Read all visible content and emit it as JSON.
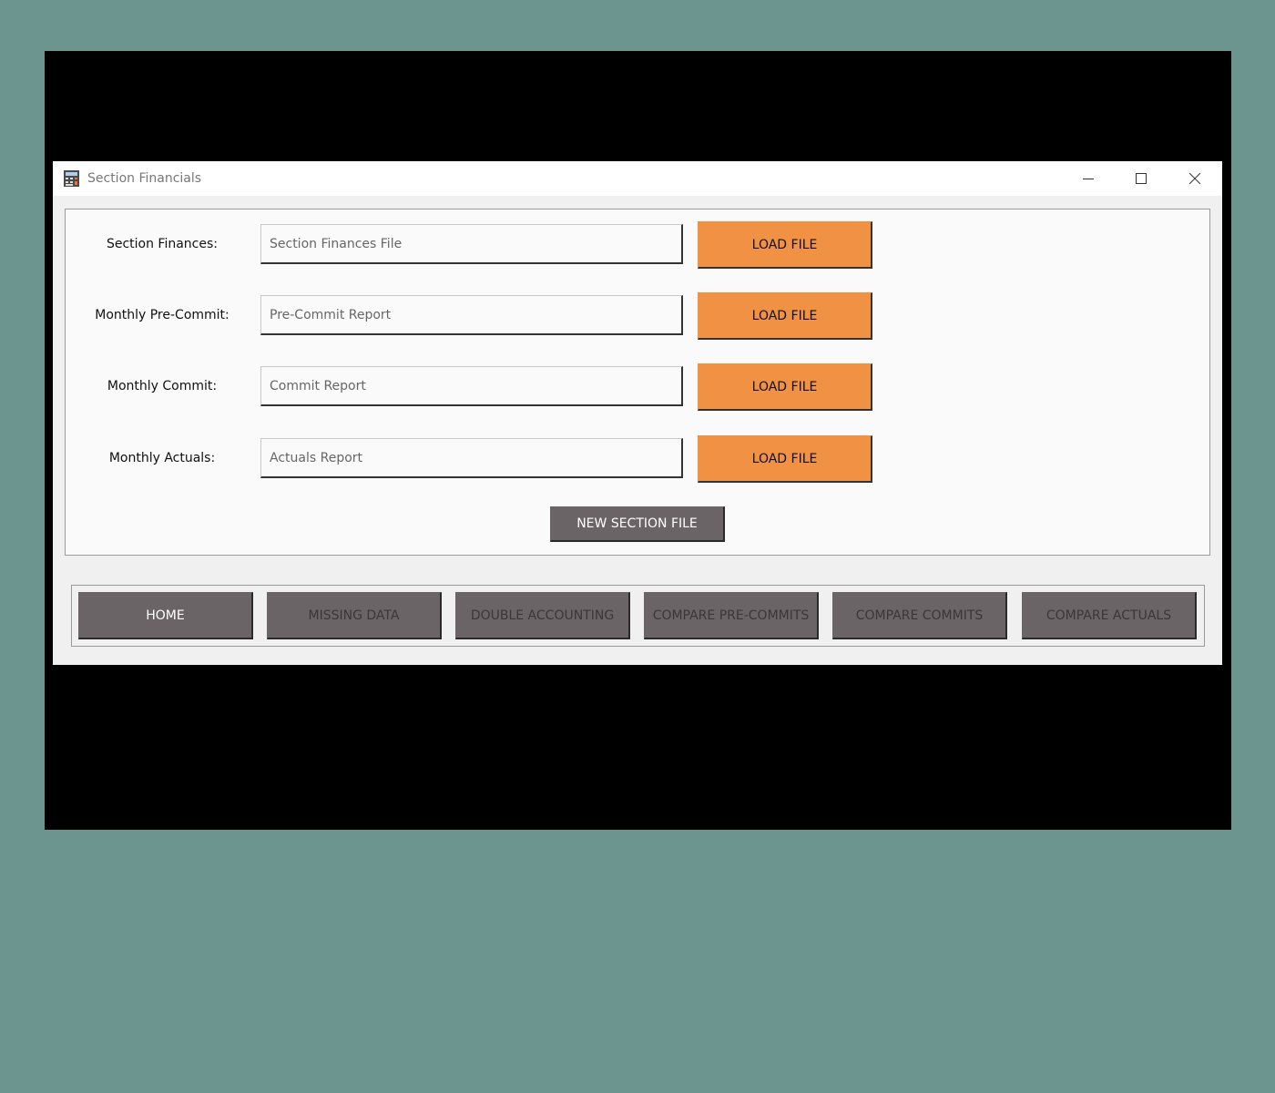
{
  "window": {
    "title": "Section Financials"
  },
  "form": {
    "rows": [
      {
        "label": "Section Finances:",
        "placeholder": "Section Finances File",
        "button": "LOAD FILE"
      },
      {
        "label": "Monthly Pre-Commit:",
        "placeholder": "Pre-Commit Report",
        "button": "LOAD FILE"
      },
      {
        "label": "Monthly Commit:",
        "placeholder": "Commit Report",
        "button": "LOAD FILE"
      },
      {
        "label": "Monthly Actuals:",
        "placeholder": "Actuals Report",
        "button": "LOAD FILE"
      }
    ],
    "new_section_label": "NEW SECTION FILE"
  },
  "nav": {
    "items": [
      {
        "label": "HOME"
      },
      {
        "label": "MISSING DATA"
      },
      {
        "label": "DOUBLE ACCOUNTING"
      },
      {
        "label": "COMPARE PRE-COMMITS"
      },
      {
        "label": "COMPARE COMMITS"
      },
      {
        "label": "COMPARE ACTUALS"
      }
    ]
  },
  "icons": {
    "app": "calculator-icon",
    "minimize": "minimize-icon",
    "maximize": "maximize-icon",
    "close": "close-icon"
  },
  "colors": {
    "desktop": "#6c9590",
    "load_button": "#f09144",
    "nav_button": "#6b6466"
  }
}
